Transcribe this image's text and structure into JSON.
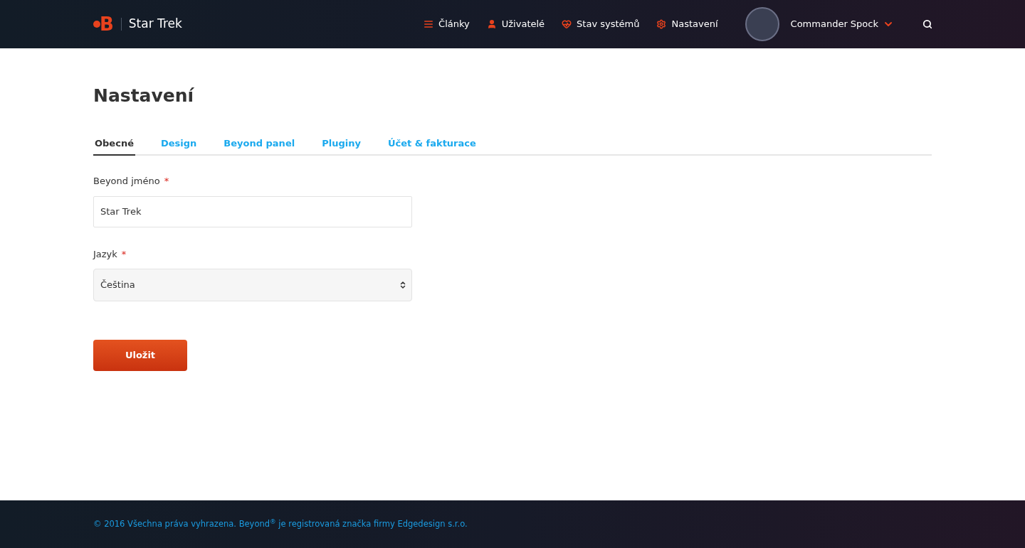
{
  "header": {
    "logo_letter": "B",
    "site_name": "Star Trek",
    "nav": [
      {
        "kind": "articles",
        "label": "Články"
      },
      {
        "kind": "users",
        "label": "Uživatelé"
      },
      {
        "kind": "status",
        "label": "Stav systémů"
      },
      {
        "kind": "settings",
        "label": "Nastavení"
      }
    ],
    "user": {
      "name": "Commander Spock"
    }
  },
  "page": {
    "title": "Nastavení",
    "tabs": [
      {
        "label": "Obecné",
        "selected": true
      },
      {
        "label": "Design",
        "selected": false
      },
      {
        "label": "Beyond panel",
        "selected": false
      },
      {
        "label": "Pluginy",
        "selected": false
      },
      {
        "label": "Účet & fakturace",
        "selected": false
      }
    ],
    "fields": [
      {
        "kind": "text",
        "label": "Beyond jméno",
        "required": true,
        "required_mark": "*",
        "value": "Star Trek"
      },
      {
        "kind": "select",
        "label": "Jazyk",
        "required": true,
        "required_mark": "*",
        "value": "Čeština"
      }
    ],
    "save_button": "Uložit"
  },
  "footer": {
    "text": "© 2016 Všechna práva vyhrazena. Beyond$^{®}$ je registrovaná značka firmy Edgedesign s.r.o."
  }
}
